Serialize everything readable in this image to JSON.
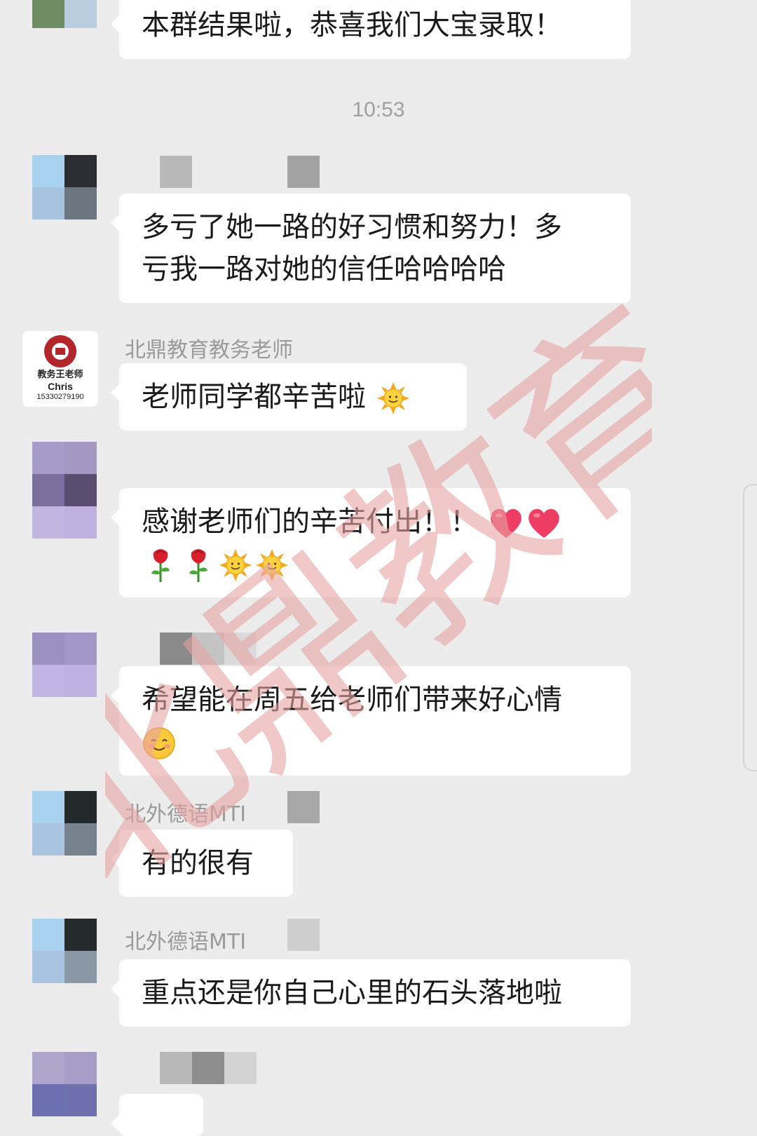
{
  "chat": {
    "timestamp": "10:53",
    "messages": [
      {
        "sender": "",
        "text": "本群结果啦，恭喜我们大宝录取！"
      },
      {
        "sender": "",
        "lines": [
          "多亏了她一路的好习惯和努力！多",
          "亏我一路对她的信任哈哈哈哈"
        ]
      },
      {
        "sender": "北鼎教育教务老师",
        "text": "老师同学都辛苦啦",
        "emoji": [
          "sun-emoji"
        ],
        "avatar": {
          "line1": "教务王老师",
          "line2": "Chris",
          "line3": "15330279190"
        }
      },
      {
        "sender": "",
        "lines": [
          "感谢老师们的辛苦付出！！"
        ],
        "emoji": [
          "heart-emoji",
          "heart-emoji",
          "rose-emoji",
          "rose-emoji",
          "sun-emoji",
          "sun-emoji"
        ]
      },
      {
        "sender": "",
        "lines": [
          "希望能在周五给老师们带来好心情"
        ],
        "emoji": [
          "blush-smile-emoji"
        ]
      },
      {
        "sender": "北外德语MTI",
        "text": "有的很有"
      },
      {
        "sender": "北外德语MTI",
        "text": "重点还是你自己心里的石头落地啦"
      },
      {
        "sender": ""
      }
    ]
  },
  "watermark": {
    "text": "北鼎教育",
    "color": "#e8a3a3"
  },
  "colors": {
    "background": "#ececec",
    "bubble": "#ffffff",
    "sender_name": "#9a9a9a",
    "timestamp": "#a0a0a0"
  }
}
